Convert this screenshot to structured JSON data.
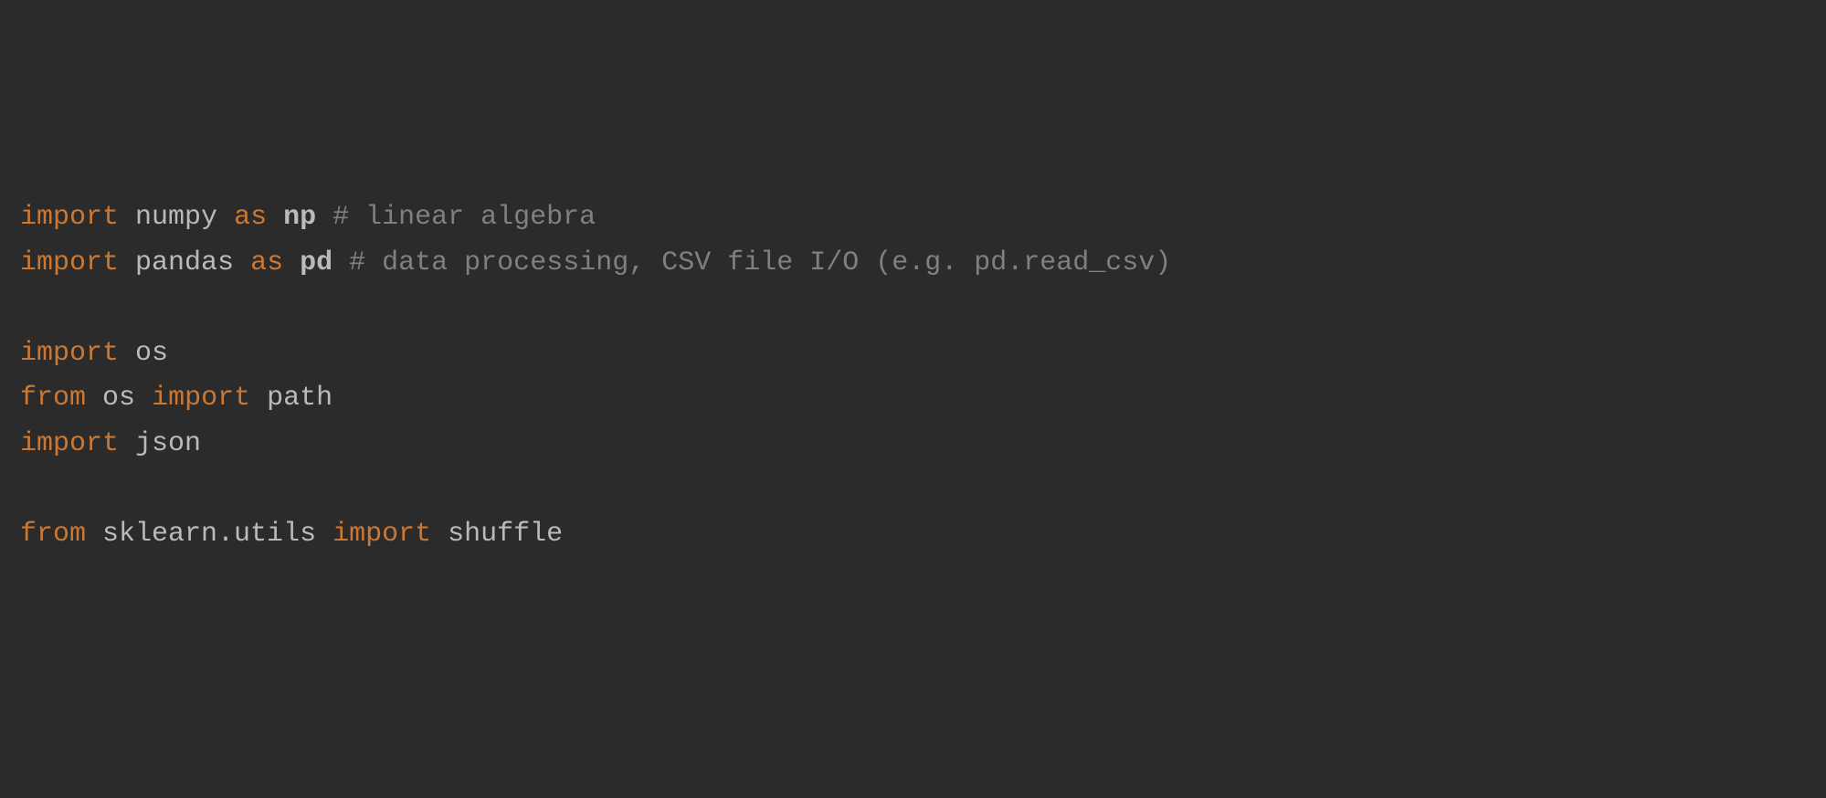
{
  "code": {
    "line1": {
      "kw_import": "import",
      "module": "numpy",
      "kw_as": "as",
      "alias": "np",
      "comment": "# linear algebra"
    },
    "line2": {
      "kw_import": "import",
      "module": "pandas",
      "kw_as": "as",
      "alias": "pd",
      "comment": "# data processing, CSV file I/O (e.g. pd.read_csv)"
    },
    "line3": "",
    "line4": {
      "kw_import": "import",
      "module": "os"
    },
    "line5": {
      "kw_from": "from",
      "module": "os",
      "kw_import": "import",
      "name": "path"
    },
    "line6": {
      "kw_import": "import",
      "module": "json"
    },
    "line7": "",
    "line8": {
      "kw_from": "from",
      "module": "sklearn.utils",
      "kw_import": "import",
      "name": "shuffle"
    }
  },
  "colors": {
    "background": "#2b2b2b",
    "keyword": "#cc7832",
    "identifier": "#bababa",
    "comment": "#808080"
  }
}
